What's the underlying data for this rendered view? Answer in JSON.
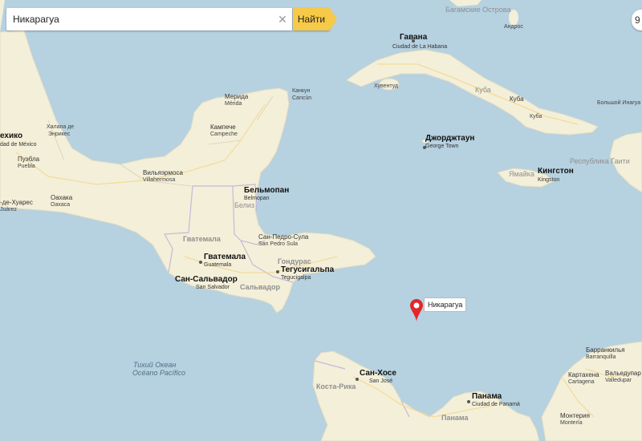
{
  "search": {
    "value": "Никарагуа",
    "placeholder": "",
    "button_label": "Найти"
  },
  "marker": {
    "label": "Никарагуа"
  },
  "labels": {
    "bahamas": "Багамские Острова",
    "andros": "Андрос",
    "habana": "Гавана",
    "habana_sub": "Ciudad de La Habana",
    "kuba_country": "Куба",
    "kuba_city": "Куба",
    "huventud": "Хувентуд",
    "bolshoy_inagua": "Большой Инагуа",
    "cancun": "Канкун",
    "cancun_sub": "Cancún",
    "merida": "Мерида",
    "merida_sub": "Mérida",
    "campeche": "Кампече",
    "campeche_sub": "Campeche",
    "mexico": "ехико",
    "mexico_sub": "dad de México",
    "jalapa": "Халапа де",
    "jalapa2": "Энрикес",
    "puebla": "Пуэбла",
    "puebla_sub": "Puebla",
    "villahermosa": "Вильяэрмоса",
    "villahermosa_sub": "Villahermosa",
    "oaxaca": "Оахака",
    "oaxaca_sub": "Oaxaca",
    "juarez": "-де-Хуарес",
    "juarez_sub": "Juárez",
    "georgetown": "Джорджтаун",
    "georgetown_sub": "George Town",
    "haiti": "Республика Гаити",
    "jamaica": "Ямайка",
    "kingston": "Кингстон",
    "kingston_sub": "Kingston",
    "belmopan": "Бельмопан",
    "belmopan_sub": "Belmopan",
    "belize": "Белиз",
    "guatemala_country": "Гватемала",
    "guatemala_city": "Гватемала",
    "guatemala_sub": "Guatemala",
    "sanpedro": "Сан-Педро-Сула",
    "sanpedro_sub": "San Pedro Sula",
    "honduras": "Гондурас",
    "tegucigalpa": "Тегусигальпа",
    "tegucigalpa_sub": "Tegucigalpa",
    "sansalvador": "Сан-Сальвадор",
    "sansalvador_sub": "San Salvador",
    "salvador": "Сальвадор",
    "pacific": "Тихий Океан",
    "pacific_sub": "Océano Pacífico",
    "sanjose": "Сан-Хосе",
    "sanjose_sub": "San José",
    "costarica": "Коста-Рика",
    "panama_city": "Панама",
    "panama_sub": "Ciudad de Panamá",
    "panama_country": "Панама",
    "barranquilla": "Барранкилья",
    "barranquilla_sub": "Barranquilla",
    "cartagena": "Картахена",
    "cartagena_sub": "Cartagena",
    "valledupar": "Вальедупар",
    "valledupar_sub": "Valledupar",
    "monteria": "Монтерия",
    "monteria_sub": "Montería"
  },
  "colors": {
    "water": "#b6d1e0",
    "land": "#f3efd9",
    "border": "#c8b8d8",
    "button": "#f7c948",
    "marker": "#e2262a"
  }
}
